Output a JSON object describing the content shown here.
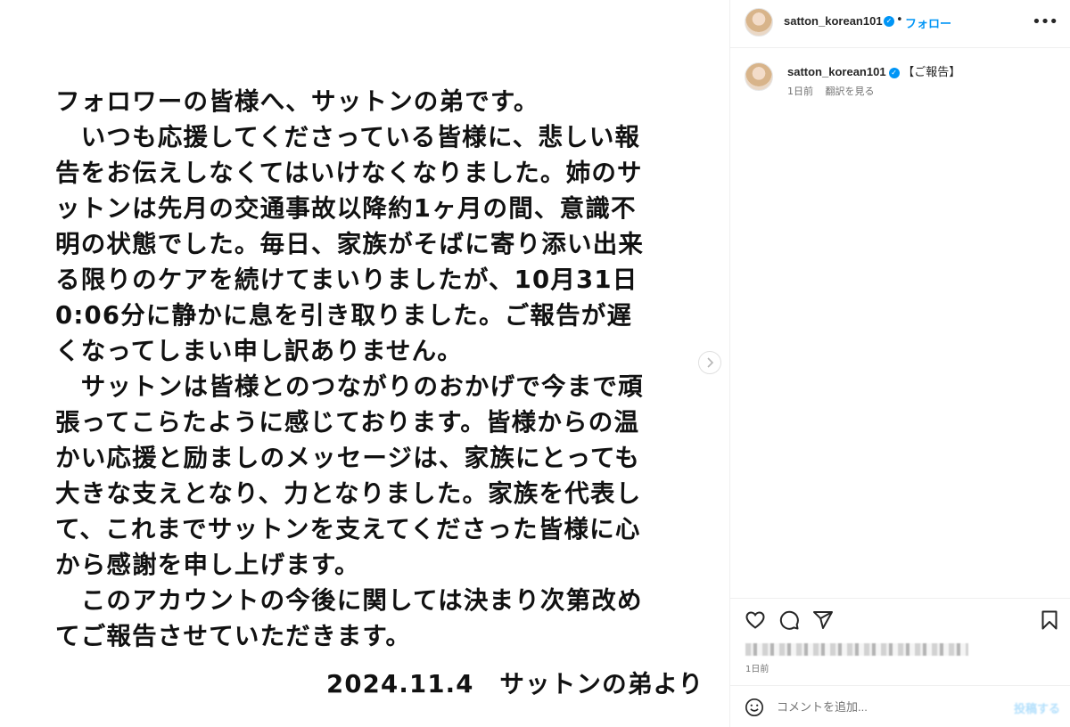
{
  "post": {
    "letter_lines": [
      "フォロワーの皆様へ、サットンの弟です。",
      "　いつも応援してくださっている皆様に、悲しい報",
      "告をお伝えしなくてはいけなくなりました。姉のサ",
      "ットンは先月の交通事故以降約1ヶ月の間、意識不",
      "明の状態でした。毎日、家族がそばに寄り添い出来",
      "る限りのケアを続けてまいりましたが、10月31日",
      "0:06分に静かに息を引き取りました。ご報告が遅",
      "くなってしまい申し訳ありません。",
      "　サットンは皆様とのつながりのおかげで今まで頑",
      "張ってこらたように感じております。皆様からの温",
      "かい応援と励ましのメッセージは、家族にとっても",
      "大きな支えとなり、力となりました。家族を代表し",
      "て、これまでサットンを支えてくださった皆様に心",
      "から感謝を申し上げます。",
      "　このアカウントの今後に関しては決まり次第改め",
      "てご報告させていただきます。"
    ],
    "signature": "2024.11.4　サットンの弟より",
    "next_icon": "chevron-right-icon"
  },
  "header": {
    "username": "satton_korean101",
    "separator": "•",
    "follow_label": "フォロー",
    "more_icon": "more-horizontal-icon"
  },
  "caption": {
    "username": "satton_korean101",
    "text": "【ご報告】",
    "time": "1日前",
    "translate_label": "翻訳を見る"
  },
  "actions": {
    "icons": [
      "heart-icon",
      "comment-icon",
      "share-icon",
      "bookmark-icon"
    ],
    "date": "1日前"
  },
  "comment": {
    "placeholder": "コメントを追加...",
    "post_label": "投稿する"
  },
  "colors": {
    "accent": "#0095f6",
    "muted": "#737373",
    "border": "#efefef"
  }
}
